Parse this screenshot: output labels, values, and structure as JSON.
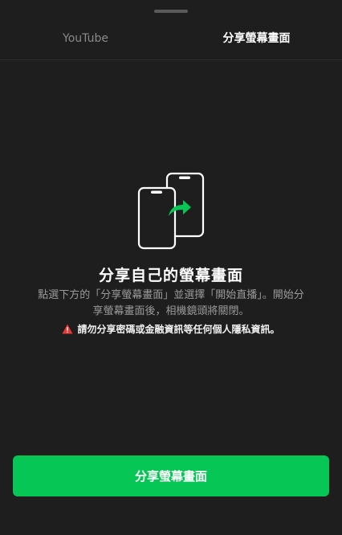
{
  "tabs": [
    {
      "label": "YouTube",
      "selected": false
    },
    {
      "label": "分享螢幕畫面",
      "selected": true
    }
  ],
  "main": {
    "title": "分享自己的螢幕畫面",
    "description": "點選下方的「分享螢幕畫面」並選擇「開始直播」。開始分享螢幕畫面後，相機鏡頭將關閉。",
    "warning": "請勿分享密碼或金融資訊等任何個人隱私資訊。",
    "illustration_icon": "phone-screen-share-icon",
    "warning_icon": "warning-triangle-icon"
  },
  "footer": {
    "button_label": "分享螢幕畫面"
  },
  "colors": {
    "background": "#1e1e1e",
    "accent": "#06c755",
    "warning": "#e53935",
    "muted_text": "#9a9a9a"
  }
}
